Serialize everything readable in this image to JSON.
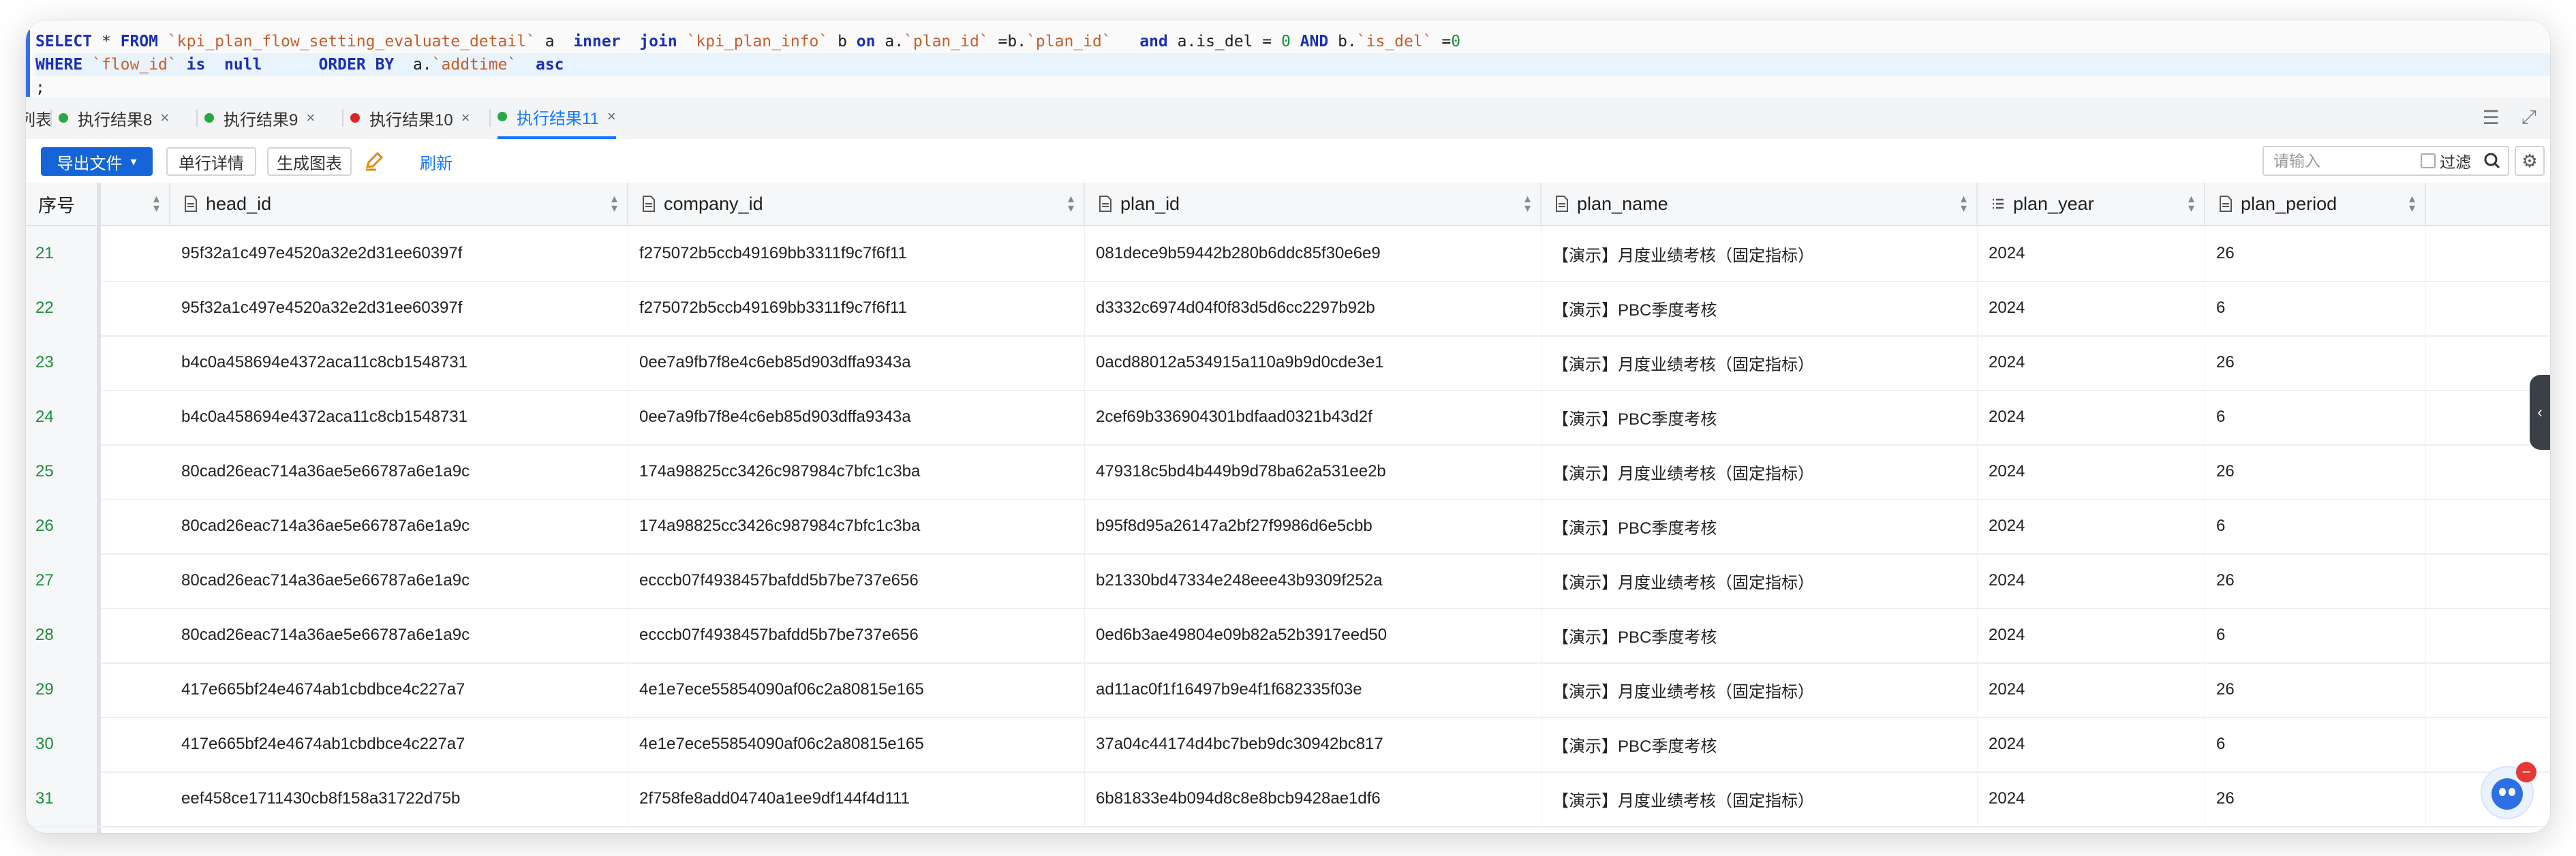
{
  "editor": {
    "line1": [
      "SELECT",
      " * ",
      "FROM",
      " ",
      "`kpi_plan_flow_setting_evaluate_detail`",
      " a  ",
      "inner",
      "  ",
      "join",
      " ",
      "`kpi_plan_info`",
      " b ",
      "on",
      " a.",
      "`plan_id`",
      " =b.",
      "`plan_id`",
      "   ",
      "and",
      " a.is_del = ",
      "0",
      " ",
      "AND",
      " b.",
      "`is_del`",
      " =",
      "0"
    ],
    "line2": [
      "WHERE",
      " ",
      "`flow_id`",
      " ",
      "is",
      "  ",
      "null",
      "      ",
      "ORDER BY",
      "  a.",
      "`addtime`",
      "  ",
      "asc"
    ],
    "line3": ";"
  },
  "tabs": {
    "items": [
      {
        "label": "列表",
        "dot": ""
      },
      {
        "label": "执行结果8",
        "dot": "#2aa745"
      },
      {
        "label": "执行结果9",
        "dot": "#2aa745"
      },
      {
        "label": "执行结果10",
        "dot": "#e02424"
      },
      {
        "label": "执行结果11",
        "dot": "#2aa745",
        "active": true
      }
    ],
    "close_glyph": "×"
  },
  "toolbar": {
    "export_label": "导出文件",
    "single_row_label": "单行详情",
    "chart_label": "生成图表",
    "refresh_label": "刷新",
    "search_placeholder": "请输入",
    "filter_label": "过滤"
  },
  "grid": {
    "rownum_header": "序号",
    "columns": [
      "head_id",
      "company_id",
      "plan_id",
      "plan_name",
      "plan_year",
      "plan_period"
    ],
    "rows": [
      [
        "21",
        "95f32a1c497e4520a32e2d31ee60397f",
        "f275072b5ccb49169bb3311f9c7f6f11",
        "081dece9b59442b280b6ddc85f30e6e9",
        "【演示】月度业绩考核（固定指标）",
        "2024",
        "26"
      ],
      [
        "22",
        "95f32a1c497e4520a32e2d31ee60397f",
        "f275072b5ccb49169bb3311f9c7f6f11",
        "d3332c6974d04f0f83d5d6cc2297b92b",
        "【演示】PBC季度考核",
        "2024",
        "6"
      ],
      [
        "23",
        "b4c0a458694e4372aca11c8cb1548731",
        "0ee7a9fb7f8e4c6eb85d903dffa9343a",
        "0acd88012a534915a110a9b9d0cde3e1",
        "【演示】月度业绩考核（固定指标）",
        "2024",
        "26"
      ],
      [
        "24",
        "b4c0a458694e4372aca11c8cb1548731",
        "0ee7a9fb7f8e4c6eb85d903dffa9343a",
        "2cef69b336904301bdfaad0321b43d2f",
        "【演示】PBC季度考核",
        "2024",
        "6"
      ],
      [
        "25",
        "80cad26eac714a36ae5e66787a6e1a9c",
        "174a98825cc3426c987984c7bfc1c3ba",
        "479318c5bd4b449b9d78ba62a531ee2b",
        "【演示】月度业绩考核（固定指标）",
        "2024",
        "26"
      ],
      [
        "26",
        "80cad26eac714a36ae5e66787a6e1a9c",
        "174a98825cc3426c987984c7bfc1c3ba",
        "b95f8d95a26147a2bf27f9986d6e5cbb",
        "【演示】PBC季度考核",
        "2024",
        "6"
      ],
      [
        "27",
        "80cad26eac714a36ae5e66787a6e1a9c",
        "ecccb07f4938457bafdd5b7be737e656",
        "b21330bd47334e248eee43b9309f252a",
        "【演示】月度业绩考核（固定指标）",
        "2024",
        "26"
      ],
      [
        "28",
        "80cad26eac714a36ae5e66787a6e1a9c",
        "ecccb07f4938457bafdd5b7be737e656",
        "0ed6b3ae49804e09b82a52b3917eed50",
        "【演示】PBC季度考核",
        "2024",
        "6"
      ],
      [
        "29",
        "417e665bf24e4674ab1cbdbce4c227a7",
        "4e1e7ece55854090af06c2a80815e165",
        "ad11ac0f1f16497b9e4f1f682335f03e",
        "【演示】月度业绩考核（固定指标）",
        "2024",
        "26"
      ],
      [
        "30",
        "417e665bf24e4674ab1cbdbce4c227a7",
        "4e1e7ece55854090af06c2a80815e165",
        "37a04c44174d4bc7beb9dc30942bc817",
        "【演示】PBC季度考核",
        "2024",
        "6"
      ],
      [
        "31",
        "eef458ce1711430cb8f158a31722d75b",
        "2f758fe8add04740a1ee9df144f4d111",
        "6b81833e4b094d8c8e8bcb9428ae1df6",
        "【演示】月度业绩考核（固定指标）",
        "2024",
        "26"
      ]
    ]
  },
  "avatar": {
    "badge": "−"
  },
  "colors": {
    "accent": "#1677ff",
    "primary_button": "#1565d8",
    "keyword": "#1a2fb8",
    "string": "#c75d2c",
    "number": "#1b8f3a"
  }
}
